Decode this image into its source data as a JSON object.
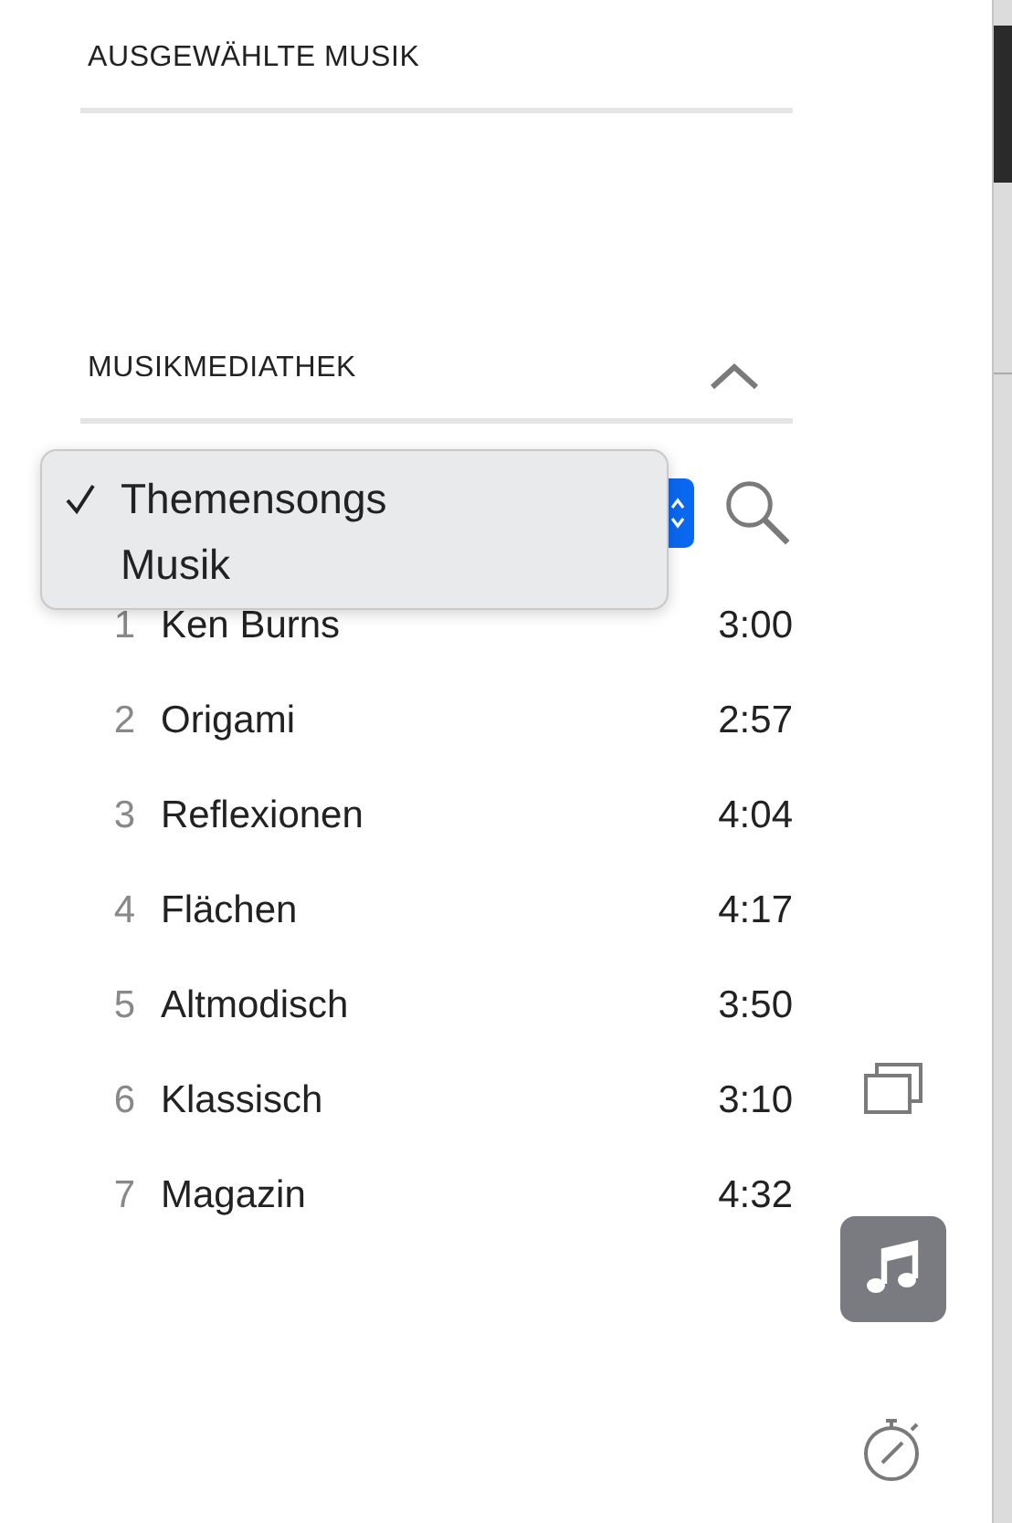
{
  "sections": [
    {
      "title": "AUSGEWÄHLTE MUSIK"
    },
    {
      "title": "MUSIKMEDIATHEK",
      "expanded": true
    }
  ],
  "menu": [
    {
      "label": "Themensongs",
      "selected": true
    },
    {
      "label": "Musik",
      "selected": false
    }
  ],
  "tracks": [
    {
      "number": "1",
      "title": "Ken Burns",
      "duration": "3:00"
    },
    {
      "number": "2",
      "title": "Origami",
      "duration": "2:57"
    },
    {
      "number": "3",
      "title": "Reflexionen",
      "duration": "4:04"
    },
    {
      "number": "4",
      "title": "Flächen",
      "duration": "4:17"
    },
    {
      "number": "5",
      "title": "Altmodisch",
      "duration": "3:50"
    },
    {
      "number": "6",
      "title": "Klassisch",
      "duration": "3:10"
    },
    {
      "number": "7",
      "title": "Magazin",
      "duration": "4:32"
    }
  ],
  "tools": [
    {
      "kind": "windows",
      "selected": false
    },
    {
      "kind": "music",
      "selected": true
    },
    {
      "kind": "timer",
      "selected": false
    }
  ]
}
